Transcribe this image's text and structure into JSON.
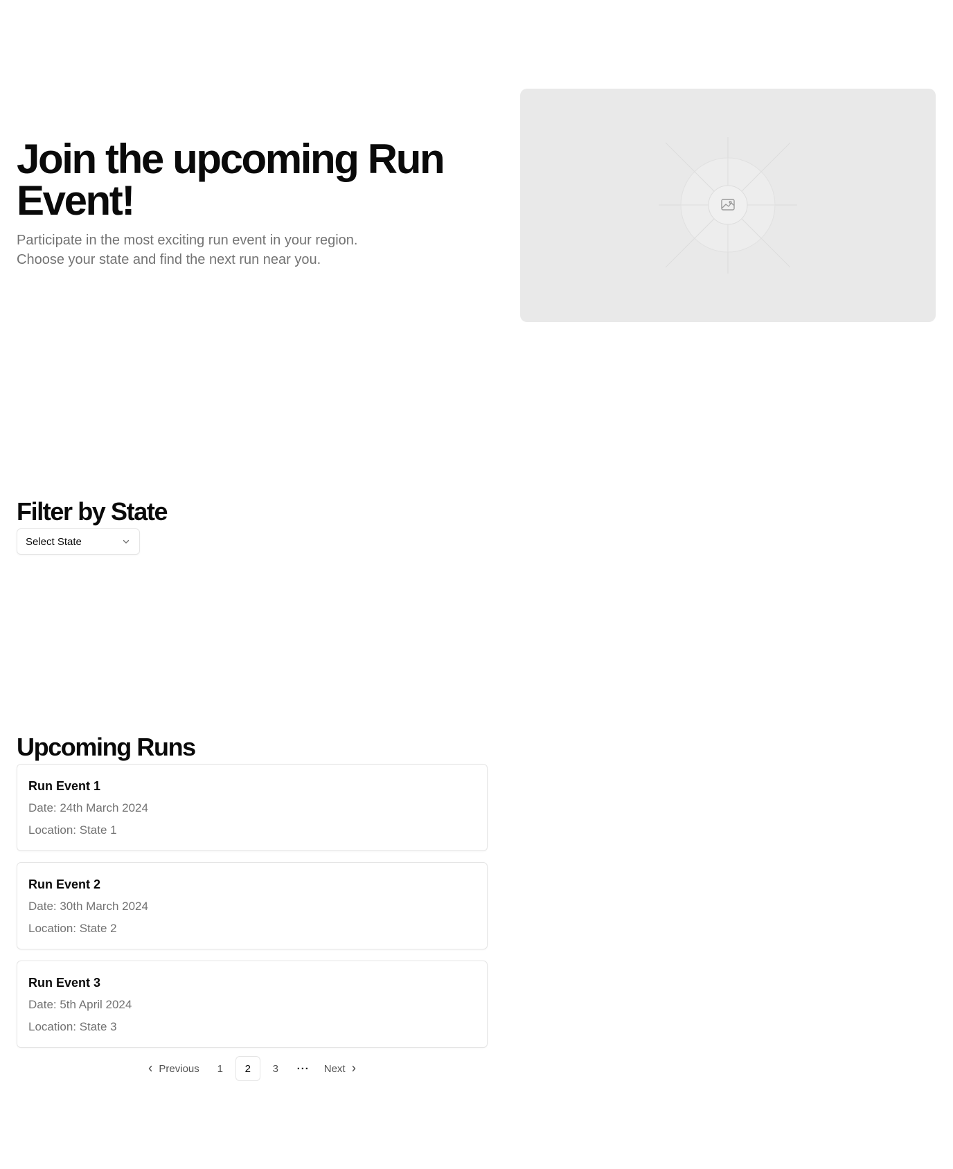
{
  "hero": {
    "title": "Join the upcoming Run Event!",
    "subtitle": "Participate in the most exciting run event in your region. Choose your state and find the next run near you.",
    "image_icon": "image-placeholder-icon"
  },
  "filter": {
    "title": "Filter by State",
    "select_value": "Select State",
    "select_icon": "chevron-down-icon"
  },
  "runs": {
    "title": "Upcoming Runs",
    "items": [
      {
        "name": "Run Event 1",
        "date": "Date: 24th March 2024",
        "location": "Location: State 1"
      },
      {
        "name": "Run Event 2",
        "date": "Date: 30th March 2024",
        "location": "Location: State 2"
      },
      {
        "name": "Run Event 3",
        "date": "Date: 5th April 2024",
        "location": "Location: State 3"
      }
    ]
  },
  "pagination": {
    "previous": "Previous",
    "next": "Next",
    "pages": [
      "1",
      "2",
      "3"
    ],
    "current": "2",
    "ellipsis": "···"
  },
  "colors": {
    "text": "#0a0a0a",
    "muted": "#737373",
    "border": "#e5e5e5",
    "placeholder_bg": "#e9e9e9"
  }
}
